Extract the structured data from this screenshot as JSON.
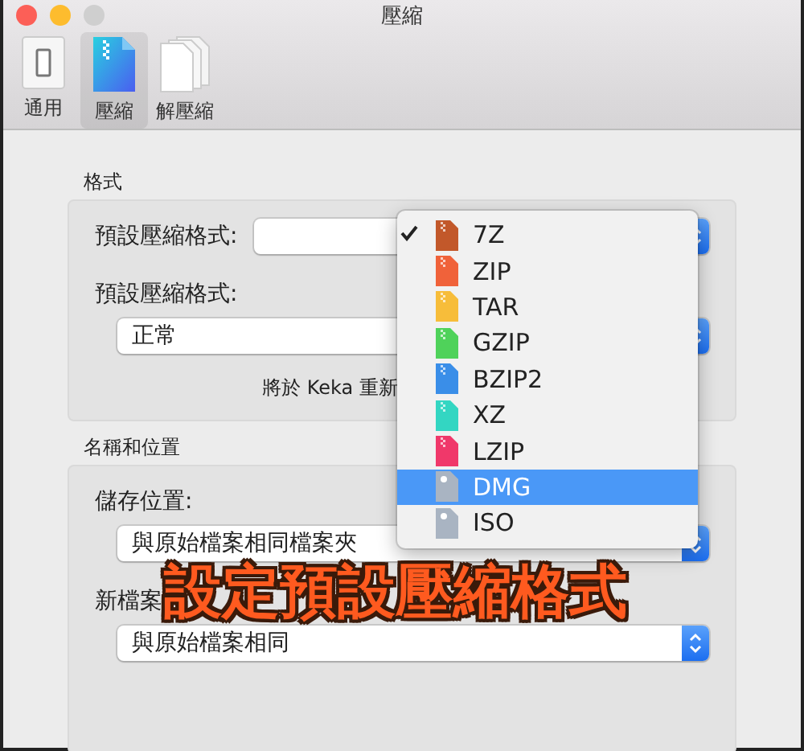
{
  "window": {
    "title": "壓縮"
  },
  "toolbar": [
    {
      "label": "通用",
      "selected": false
    },
    {
      "label": "壓縮",
      "selected": true
    },
    {
      "label": "解壓縮",
      "selected": false
    }
  ],
  "format_section": {
    "title": "格式",
    "default_format_label": "預設壓縮格式:",
    "level_label": "預設壓縮格式:",
    "level_value": "正常",
    "note": "將於 Keka 重新"
  },
  "location_section": {
    "title": "名稱和位置",
    "save_label": "儲存位置:",
    "save_value": "與原始檔案相同檔案夾",
    "name_label": "新檔案",
    "name_value": "與原始檔案相同"
  },
  "format_menu": [
    {
      "label": "7Z",
      "kind": "archive",
      "color": "#c2582a",
      "checked": true,
      "selected": false
    },
    {
      "label": "ZIP",
      "kind": "archive",
      "color": "#f0623a",
      "checked": false,
      "selected": false
    },
    {
      "label": "TAR",
      "kind": "archive",
      "color": "#f7bd3a",
      "checked": false,
      "selected": false
    },
    {
      "label": "GZIP",
      "kind": "archive",
      "color": "#4fd25a",
      "checked": false,
      "selected": false
    },
    {
      "label": "BZIP2",
      "kind": "archive",
      "color": "#3a8ee8",
      "checked": false,
      "selected": false
    },
    {
      "label": "XZ",
      "kind": "archive",
      "color": "#33d6c2",
      "checked": false,
      "selected": false
    },
    {
      "label": "LZIP",
      "kind": "archive",
      "color": "#f0386a",
      "checked": false,
      "selected": false
    },
    {
      "label": "DMG",
      "kind": "disk",
      "color": "#a9b4c2",
      "checked": false,
      "selected": true
    },
    {
      "label": "ISO",
      "kind": "disk",
      "color": "#a9b4c2",
      "checked": false,
      "selected": false
    }
  ],
  "caption": "設定預設壓縮格式"
}
